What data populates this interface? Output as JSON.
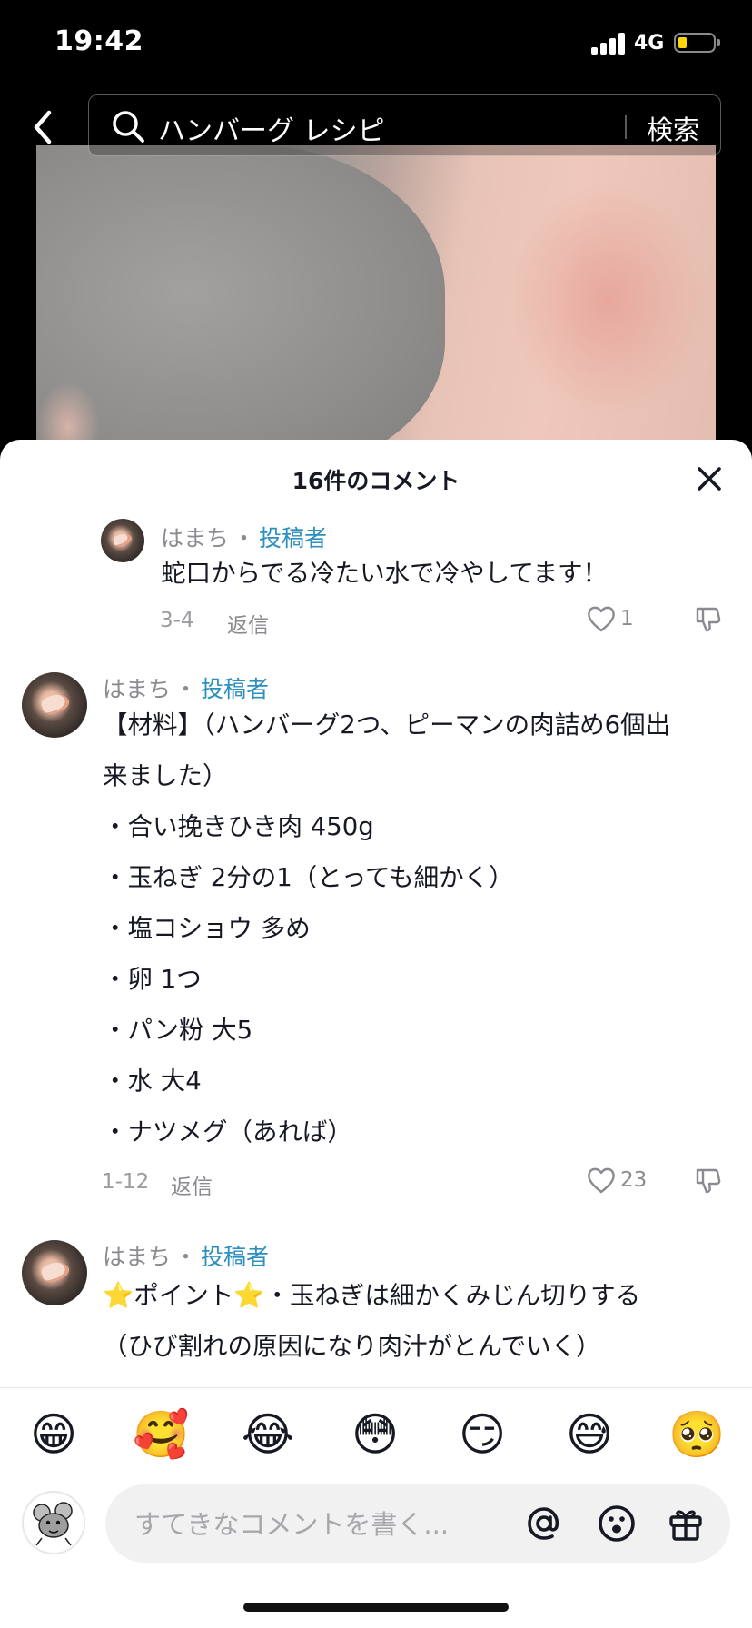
{
  "status_bar": {
    "time": "19:42",
    "network": "4G"
  },
  "search": {
    "query": "ハンバーグ レシピ",
    "submit_label": "検索"
  },
  "comments_sheet": {
    "title": "16件のコメント",
    "comments": [
      {
        "author": "はまち",
        "separator": "・",
        "role": "投稿者",
        "lines": [
          "蛇口からでる冷たい水で冷やしてます！"
        ],
        "date": "3-4",
        "reply_label": "返信",
        "likes": "1"
      },
      {
        "author": "はまち",
        "separator": "・",
        "role": "投稿者",
        "lines": [
          "【材料】（ハンバーグ2つ、ピーマンの肉詰め6個出",
          "来ました）",
          "・合い挽きひき肉 450g",
          "・玉ねぎ 2分の1（とっても細かく）",
          "・塩コショウ 多め",
          "・卵 1つ",
          "・パン粉 大5",
          "・水 大4",
          "・ナツメグ（あれば）"
        ],
        "date": "1-12",
        "reply_label": "返信",
        "likes": "23"
      },
      {
        "author": "はまち",
        "separator": "・",
        "role": "投稿者",
        "lines": [
          "⭐ポイント⭐・玉ねぎは細かくみじん切りする",
          "（ひび割れの原因になり肉汁がとんでいく）"
        ]
      }
    ]
  },
  "emoji_bar": [
    "😁",
    "🥰",
    "😂",
    "😳",
    "😏",
    "😅",
    "🥺"
  ],
  "composer": {
    "placeholder": "すてきなコメントを書く..."
  },
  "colors": {
    "role_accent": "#2d8fbd",
    "battery_level": "#ffd60a"
  }
}
